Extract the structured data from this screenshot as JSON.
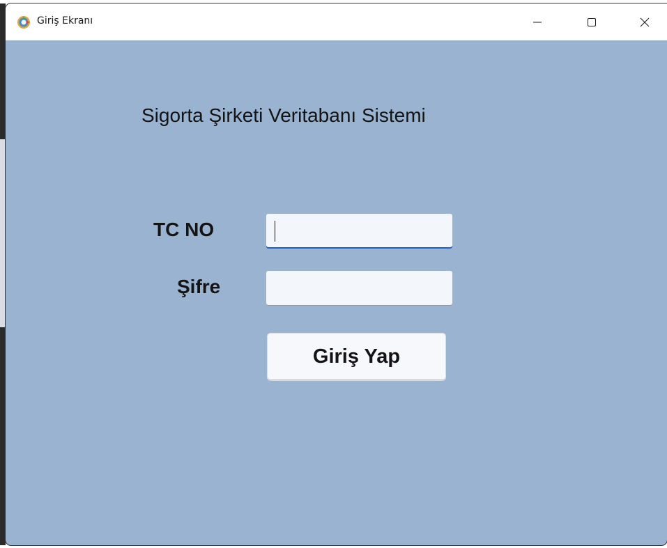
{
  "window": {
    "title": "Giriş Ekranı",
    "app_icon": "app-logo-icon",
    "controls": {
      "minimize_icon": "minimize-icon",
      "maximize_icon": "maximize-icon",
      "close_icon": "close-icon"
    }
  },
  "form": {
    "heading": "Sigorta Şirketi Veritabanı Sistemi",
    "tc_label": "TC NO",
    "tc_value": "",
    "password_label": "Şifre",
    "password_value": "",
    "login_button": "Giriş Yap"
  },
  "colors": {
    "form_background": "#9ab3d1",
    "focus_underline": "#1f5fc0"
  }
}
